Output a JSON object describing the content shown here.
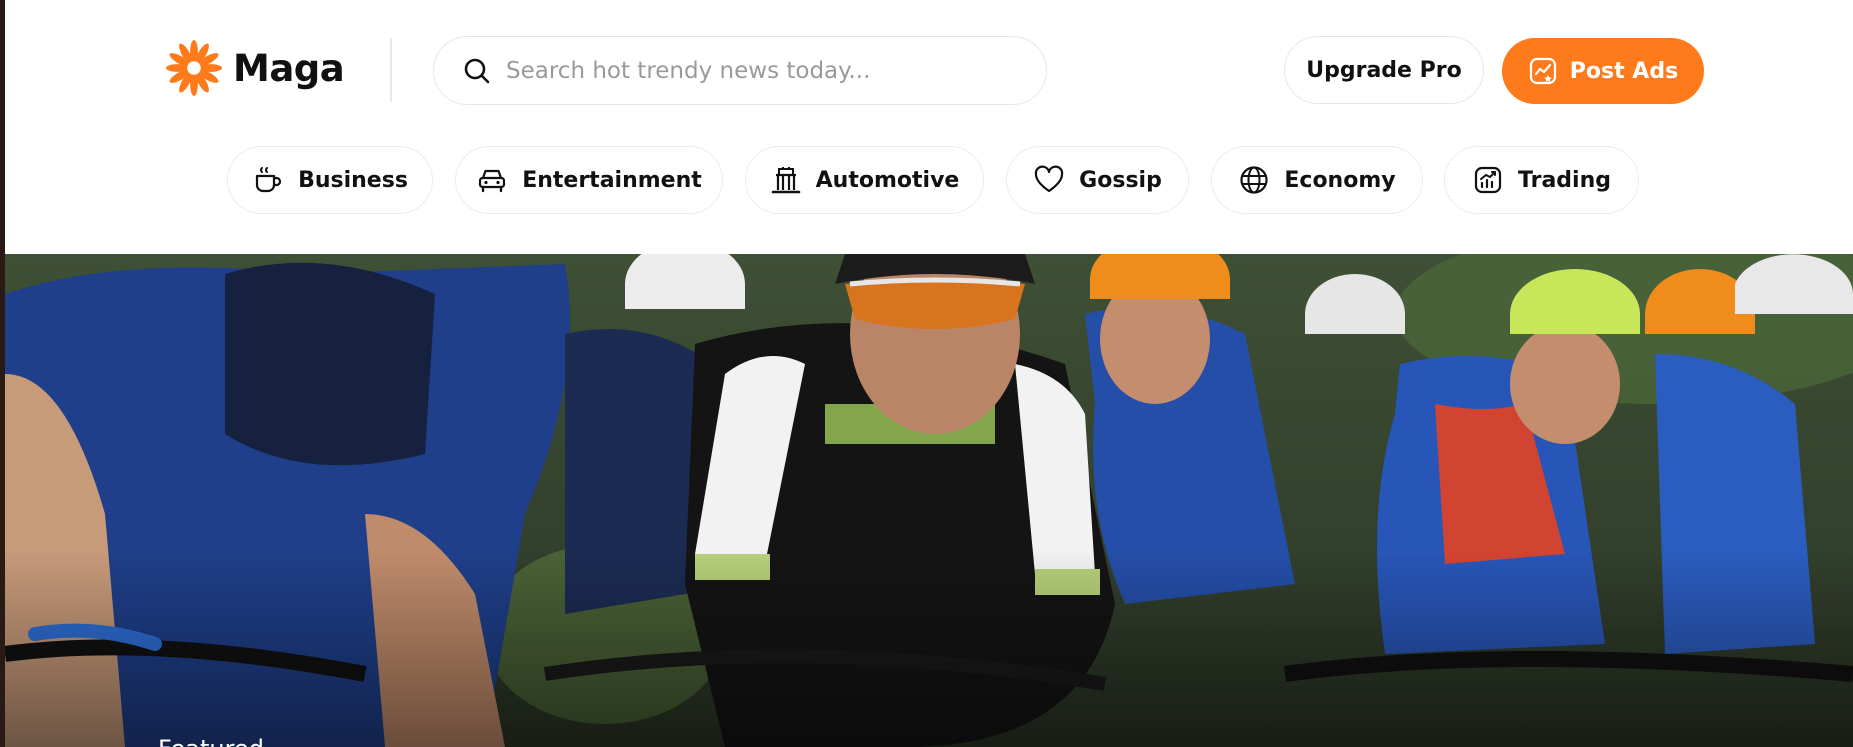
{
  "brand": {
    "name": "Maga",
    "accent_color": "#ff7a1a"
  },
  "search": {
    "placeholder": "Search hot trendy news today...",
    "value": "",
    "icon": "search-icon"
  },
  "header_actions": {
    "upgrade_label": "Upgrade Pro",
    "post_label": "Post Ads",
    "post_icon": "chart-star-icon"
  },
  "categories": [
    {
      "label": "Business",
      "icon": "coffee-cup-icon"
    },
    {
      "label": "Entertainment",
      "icon": "car-icon"
    },
    {
      "label": "Automotive",
      "icon": "building-icon"
    },
    {
      "label": "Gossip",
      "icon": "heart-icon"
    },
    {
      "label": "Economy",
      "icon": "globe-icon"
    },
    {
      "label": "Trading",
      "icon": "trend-chart-icon"
    }
  ],
  "hero": {
    "image": "cyclists-racing-photo",
    "tag": "Featured"
  }
}
